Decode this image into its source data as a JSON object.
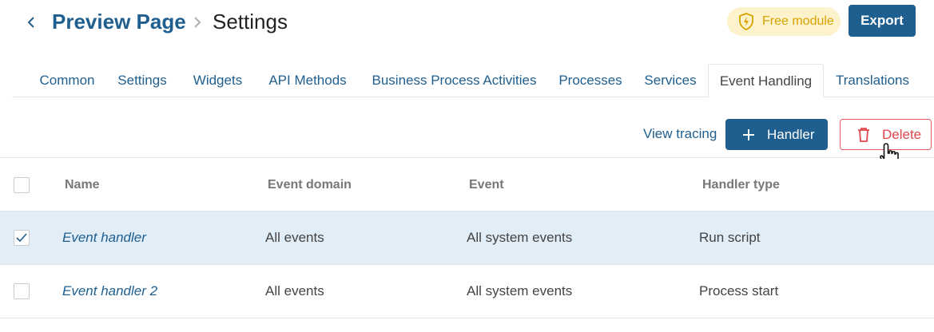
{
  "breadcrumb": {
    "root": "Preview Page",
    "current": "Settings"
  },
  "badge": {
    "label": "Free module",
    "icon": "lightning-shield-icon",
    "color": "#d9a300"
  },
  "header": {
    "export_label": "Export"
  },
  "tabs": [
    {
      "label": "Common"
    },
    {
      "label": "Settings"
    },
    {
      "label": "Widgets"
    },
    {
      "label": "API Methods"
    },
    {
      "label": "Business Process Activities"
    },
    {
      "label": "Processes"
    },
    {
      "label": "Services"
    },
    {
      "label": "Event Handling",
      "active": true
    },
    {
      "label": "Translations"
    }
  ],
  "toolbar": {
    "tracing_label": "View tracing",
    "handler_label": "Handler",
    "delete_label": "Delete"
  },
  "table": {
    "columns": [
      "Name",
      "Event domain",
      "Event",
      "Handler type"
    ],
    "rows": [
      {
        "name": "Event handler",
        "domain": "All events",
        "event": "All system events",
        "type": "Run script",
        "checked": true
      },
      {
        "name": "Event handler 2",
        "domain": "All events",
        "event": "All system events",
        "type": "Process start",
        "checked": false
      }
    ]
  },
  "colors": {
    "primary": "#1f5f8f",
    "danger": "#e0464e",
    "selected_row": "#e1edf7",
    "badge_bg": "#fcf2cc"
  }
}
